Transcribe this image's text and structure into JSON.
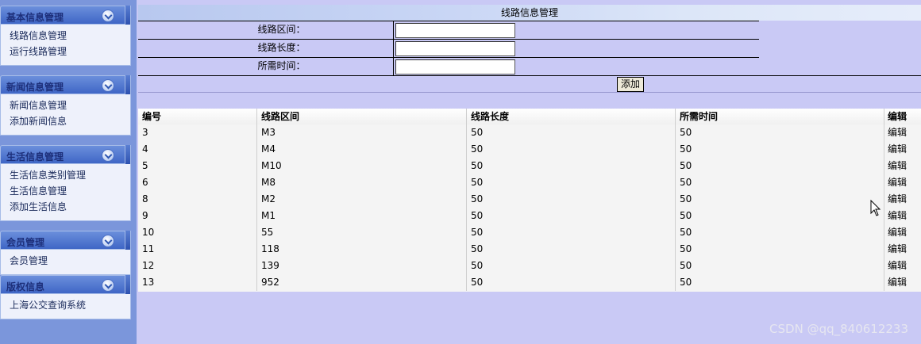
{
  "sidebar": {
    "menus": [
      {
        "title": "基本信息管理",
        "items": [
          "线路信息管理",
          "运行线路管理"
        ]
      },
      {
        "title": "新闻信息管理",
        "items": [
          "新闻信息管理",
          "添加新闻信息"
        ]
      },
      {
        "title": "生活信息管理",
        "items": [
          "生活信息类别管理",
          "生活信息管理",
          "添加生活信息"
        ]
      },
      {
        "title": "会员管理",
        "items": [
          "会员管理"
        ]
      },
      {
        "title": "版权信息",
        "items": [
          "上海公交查询系统"
        ]
      }
    ]
  },
  "form": {
    "title": "线路信息管理",
    "fields": [
      {
        "label": "线路区间：",
        "value": ""
      },
      {
        "label": "线路长度：",
        "value": ""
      },
      {
        "label": "所需时间：",
        "value": ""
      }
    ],
    "submit_label": "添加"
  },
  "table": {
    "columns": [
      "编号",
      "线路区间",
      "线路长度",
      "所需时间",
      "编辑"
    ],
    "rows": [
      [
        "3",
        "M3",
        "50",
        "50",
        "编辑"
      ],
      [
        "4",
        "M4",
        "50",
        "50",
        "编辑"
      ],
      [
        "5",
        "M10",
        "50",
        "50",
        "编辑"
      ],
      [
        "6",
        "M8",
        "50",
        "50",
        "编辑"
      ],
      [
        "8",
        "M2",
        "50",
        "50",
        "编辑"
      ],
      [
        "9",
        "M1",
        "50",
        "50",
        "编辑"
      ],
      [
        "10",
        "55",
        "50",
        "50",
        "编辑"
      ],
      [
        "11",
        "118",
        "50",
        "50",
        "编辑"
      ],
      [
        "12",
        "139",
        "50",
        "50",
        "编辑"
      ],
      [
        "13",
        "952",
        "50",
        "50",
        "编辑"
      ]
    ]
  },
  "watermark": "CSDN @qq_840612233",
  "icons": {
    "menu_toggle": "chevron-down-icon",
    "pointer": "mouse-pointer-icon"
  },
  "colors": {
    "sidebar_bg": "#7b96db",
    "main_bg": "#c9c9f5",
    "menu_header": "#3f66c6",
    "table_bg": "#f4f4f4"
  }
}
